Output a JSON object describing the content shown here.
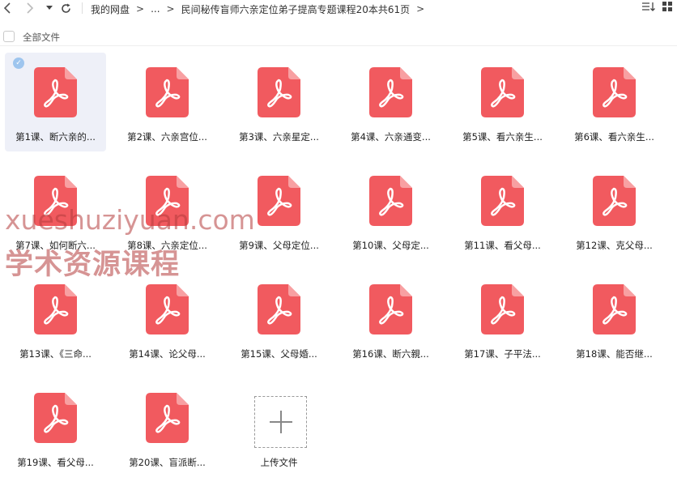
{
  "toolbar": {
    "back_icon": "chevron-left-icon",
    "forward_icon": "chevron-right-icon",
    "history_icon": "caret-down-icon",
    "refresh_icon": "refresh-icon",
    "sort_icon": "sort-icon",
    "view_icon": "grid-view-icon"
  },
  "breadcrumb": {
    "root": "我的网盘",
    "ellipsis": "...",
    "current": "民间秘传盲师六亲定位弟子提高专题课程20本共61页"
  },
  "selectbar": {
    "label": "全部文件"
  },
  "files": [
    {
      "name": "第1课、断六亲的...",
      "selected": true
    },
    {
      "name": "第2课、六亲宫位...",
      "selected": false
    },
    {
      "name": "第3课、六亲星定...",
      "selected": false
    },
    {
      "name": "第4课、六亲通变...",
      "selected": false
    },
    {
      "name": "第5课、看六亲生...",
      "selected": false
    },
    {
      "name": "第6课、看六亲生...",
      "selected": false
    },
    {
      "name": "第7课、如何断六...",
      "selected": false
    },
    {
      "name": "第8课、六亲定位...",
      "selected": false
    },
    {
      "name": "第9课、父母定位...",
      "selected": false
    },
    {
      "name": "第10课、父母定...",
      "selected": false
    },
    {
      "name": "第11课、看父母...",
      "selected": false
    },
    {
      "name": "第12课、克父母...",
      "selected": false
    },
    {
      "name": "第13课、《三命...",
      "selected": false
    },
    {
      "name": "第14课、论父母...",
      "selected": false
    },
    {
      "name": "第15课、父母婚...",
      "selected": false
    },
    {
      "name": "第16课、断六親...",
      "selected": false
    },
    {
      "name": "第17课、子平法...",
      "selected": false
    },
    {
      "name": "第18课、能否继...",
      "selected": false
    },
    {
      "name": "第19课、看父母...",
      "selected": false
    },
    {
      "name": "第20课、盲派断...",
      "selected": false
    }
  ],
  "upload": {
    "label": "上传文件"
  },
  "watermark": {
    "line1": "xueshuziyuan.com",
    "line2": "学术资源课程"
  },
  "colors": {
    "pdf": "#f15a5f",
    "selected_bg": "#eef0f8",
    "check": "#9ec5ee"
  }
}
